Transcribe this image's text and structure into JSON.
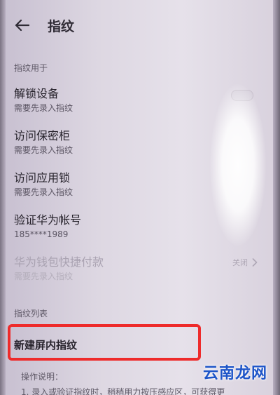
{
  "header": {
    "title": "指纹"
  },
  "section_usage": {
    "label": "指纹用于"
  },
  "items": [
    {
      "title": "解锁设备",
      "subtitle": "需要先录入指纹"
    },
    {
      "title": "访问保密柜",
      "subtitle": "需要先录入指纹"
    },
    {
      "title": "访问应用锁",
      "subtitle": "需要先录入指纹"
    },
    {
      "title": "验证华为帐号",
      "subtitle": "185****1989"
    },
    {
      "title": "华为钱包快捷付款",
      "subtitle": "需要先录入指纹",
      "status": "关闭"
    }
  ],
  "section_list": {
    "label": "指纹列表"
  },
  "new_fingerprint": {
    "label": "新建屏内指纹"
  },
  "help": {
    "title": "操作说明：",
    "line1": "1. 录入或验证指纹时，稍稍用力按压感应区，可获得更"
  },
  "watermark": {
    "text": "云南龙网"
  },
  "colors": {
    "highlight": "#ee2b2b",
    "watermark": "#1e55c8"
  },
  "icons": {
    "back": "arrow-left",
    "status_chevron": "chevron-right"
  }
}
